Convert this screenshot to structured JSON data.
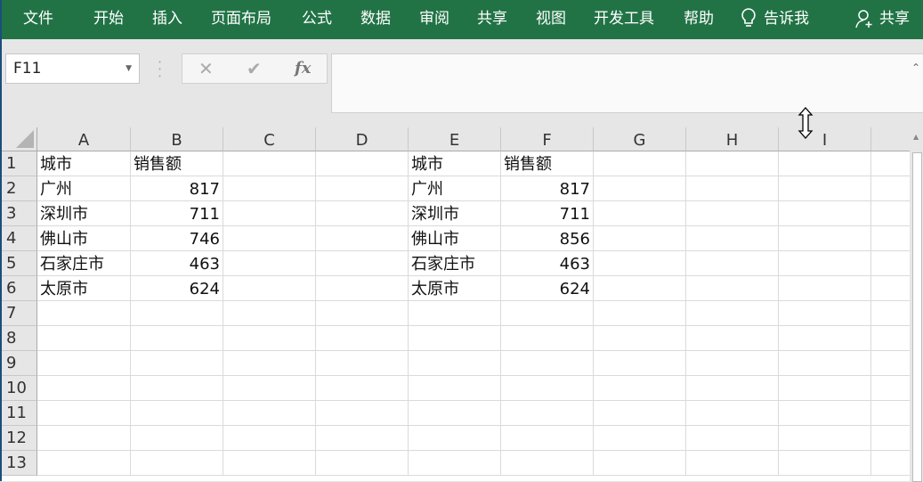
{
  "ribbon": {
    "tabs": [
      "文件",
      "开始",
      "插入",
      "页面布局",
      "公式",
      "数据",
      "审阅",
      "共享",
      "视图",
      "开发工具",
      "帮助"
    ],
    "tell_me": "告诉我",
    "share": "共享",
    "bg_color": "#217346"
  },
  "formula_bar": {
    "name_box": "F11",
    "cancel_icon": "✕",
    "enter_icon": "✔",
    "fx_label": "fx",
    "formula_value": ""
  },
  "sheet": {
    "columns": [
      "A",
      "B",
      "C",
      "D",
      "E",
      "F",
      "G",
      "H",
      "I"
    ],
    "rows": [
      "1",
      "2",
      "3",
      "4",
      "5",
      "6",
      "7",
      "8",
      "9",
      "10",
      "11",
      "12",
      "13"
    ],
    "cells": [
      {
        "ref": "A1",
        "col": 0,
        "row": 0,
        "value": "城市",
        "type": "text"
      },
      {
        "ref": "B1",
        "col": 1,
        "row": 0,
        "value": "销售额",
        "type": "text"
      },
      {
        "ref": "A2",
        "col": 0,
        "row": 1,
        "value": "广州",
        "type": "text"
      },
      {
        "ref": "B2",
        "col": 1,
        "row": 1,
        "value": "817",
        "type": "num"
      },
      {
        "ref": "A3",
        "col": 0,
        "row": 2,
        "value": "深圳市",
        "type": "text"
      },
      {
        "ref": "B3",
        "col": 1,
        "row": 2,
        "value": "711",
        "type": "num"
      },
      {
        "ref": "A4",
        "col": 0,
        "row": 3,
        "value": "佛山市",
        "type": "text"
      },
      {
        "ref": "B4",
        "col": 1,
        "row": 3,
        "value": "746",
        "type": "num"
      },
      {
        "ref": "A5",
        "col": 0,
        "row": 4,
        "value": "石家庄市",
        "type": "text"
      },
      {
        "ref": "B5",
        "col": 1,
        "row": 4,
        "value": "463",
        "type": "num"
      },
      {
        "ref": "A6",
        "col": 0,
        "row": 5,
        "value": "太原市",
        "type": "text"
      },
      {
        "ref": "B6",
        "col": 1,
        "row": 5,
        "value": "624",
        "type": "num"
      },
      {
        "ref": "E1",
        "col": 4,
        "row": 0,
        "value": "城市",
        "type": "text"
      },
      {
        "ref": "F1",
        "col": 5,
        "row": 0,
        "value": "销售额",
        "type": "text"
      },
      {
        "ref": "E2",
        "col": 4,
        "row": 1,
        "value": "广州",
        "type": "text"
      },
      {
        "ref": "F2",
        "col": 5,
        "row": 1,
        "value": "817",
        "type": "num"
      },
      {
        "ref": "E3",
        "col": 4,
        "row": 2,
        "value": "深圳市",
        "type": "text"
      },
      {
        "ref": "F3",
        "col": 5,
        "row": 2,
        "value": "711",
        "type": "num"
      },
      {
        "ref": "E4",
        "col": 4,
        "row": 3,
        "value": "佛山市",
        "type": "text"
      },
      {
        "ref": "F4",
        "col": 5,
        "row": 3,
        "value": "856",
        "type": "num"
      },
      {
        "ref": "E5",
        "col": 4,
        "row": 4,
        "value": "石家庄市",
        "type": "text"
      },
      {
        "ref": "F5",
        "col": 5,
        "row": 4,
        "value": "463",
        "type": "num"
      },
      {
        "ref": "E6",
        "col": 4,
        "row": 5,
        "value": "太原市",
        "type": "text"
      },
      {
        "ref": "F6",
        "col": 5,
        "row": 5,
        "value": "624",
        "type": "num"
      }
    ]
  }
}
